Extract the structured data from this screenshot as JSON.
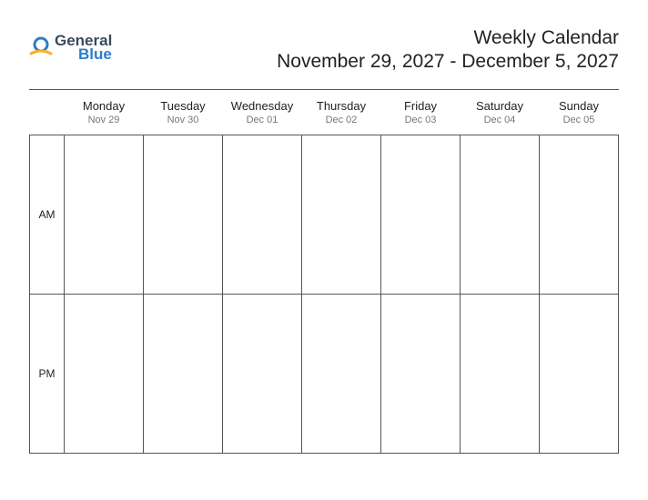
{
  "logo": {
    "text1": "General",
    "text2": "Blue"
  },
  "header": {
    "title": "Weekly Calendar",
    "date_range": "November 29, 2027 - December 5, 2027"
  },
  "periods": {
    "am": "AM",
    "pm": "PM"
  },
  "days": [
    {
      "name": "Monday",
      "date": "Nov 29"
    },
    {
      "name": "Tuesday",
      "date": "Nov 30"
    },
    {
      "name": "Wednesday",
      "date": "Dec 01"
    },
    {
      "name": "Thursday",
      "date": "Dec 02"
    },
    {
      "name": "Friday",
      "date": "Dec 03"
    },
    {
      "name": "Saturday",
      "date": "Dec 04"
    },
    {
      "name": "Sunday",
      "date": "Dec 05"
    }
  ]
}
